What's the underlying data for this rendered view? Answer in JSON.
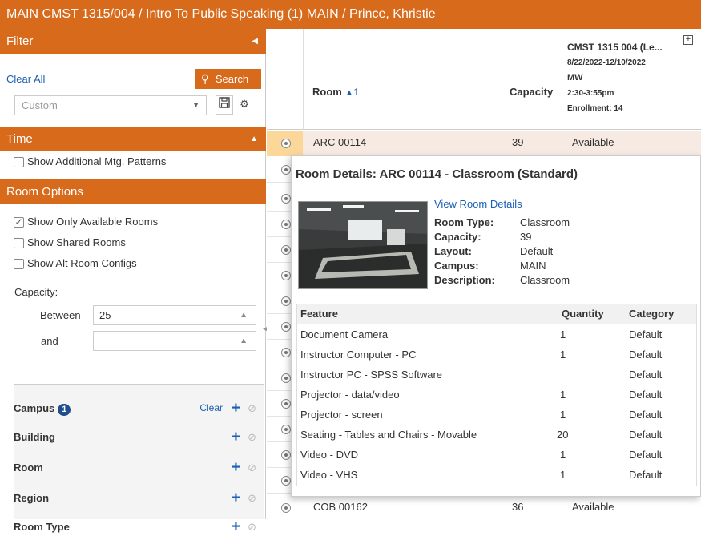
{
  "window_title": "MAIN CMST 1315/004 / Intro To Public Speaking (1) MAIN / Prince, Khristie",
  "filter": {
    "header": "Filter",
    "clear_all": "Clear All",
    "search_label": "Search",
    "preset_value": "Custom"
  },
  "time": {
    "header": "Time",
    "show_additional_label": "Show Additional Mtg. Patterns"
  },
  "room_options": {
    "header": "Room Options",
    "show_available_label": "Show Only Available Rooms",
    "show_available_checked": true,
    "show_shared_label": "Show Shared Rooms",
    "show_alt_label": "Show Alt Room Configs",
    "capacity_label": "Capacity:",
    "between_label": "Between",
    "between_value": "25",
    "and_label": "and",
    "and_value": ""
  },
  "facets": {
    "campus": {
      "label": "Campus",
      "count": "1",
      "clear": "Clear"
    },
    "building": {
      "label": "Building"
    },
    "room": {
      "label": "Room"
    },
    "region": {
      "label": "Region"
    },
    "room_type": {
      "label": "Room Type"
    }
  },
  "grid": {
    "room_header": "Room",
    "room_sort": "1",
    "capacity_header": "Capacity",
    "section": {
      "title": "CMST 1315 004 (Le...",
      "dates": "8/22/2022-12/10/2022",
      "days": "MW",
      "time": "2:30-3:55pm",
      "enrollment": "Enrollment: 14"
    },
    "rows": [
      {
        "room": "ARC 00114",
        "capacity": "39",
        "status": "Available"
      },
      {
        "room": "COB 00162",
        "capacity": "36",
        "status": "Available"
      }
    ]
  },
  "popup": {
    "title": "Room Details: ARC 00114 - Classroom (Standard)",
    "view_link": "View Room Details",
    "details": [
      {
        "label": "Room Type:",
        "value": "Classroom"
      },
      {
        "label": "Capacity:",
        "value": "39"
      },
      {
        "label": "Layout:",
        "value": "Default"
      },
      {
        "label": "Campus:",
        "value": "MAIN"
      },
      {
        "label": "Description:",
        "value": "Classroom"
      }
    ],
    "feature_headers": {
      "feature": "Feature",
      "quantity": "Quantity",
      "category": "Category"
    },
    "features": [
      {
        "feature": "Document Camera",
        "quantity": "1",
        "category": "Default"
      },
      {
        "feature": "Instructor Computer - PC",
        "quantity": "1",
        "category": "Default"
      },
      {
        "feature": "Instructor PC - SPSS Software",
        "quantity": "",
        "category": "Default"
      },
      {
        "feature": "Projector - data/video",
        "quantity": "1",
        "category": "Default"
      },
      {
        "feature": "Projector - screen",
        "quantity": "1",
        "category": "Default"
      },
      {
        "feature": "Seating - Tables and Chairs - Movable",
        "quantity": "20",
        "category": "Default"
      },
      {
        "feature": "Video - DVD",
        "quantity": "1",
        "category": "Default"
      },
      {
        "feature": "Video - VHS",
        "quantity": "1",
        "category": "Default"
      }
    ]
  },
  "colors": {
    "brand_orange": "#d86a1c",
    "link_blue": "#1a5fb4",
    "badge_navy": "#1e4f8c"
  },
  "icons": [
    "search-icon",
    "save-icon",
    "gear-icon",
    "collapse-left-icon",
    "collapse-up-icon",
    "dropdown-caret-icon",
    "spinner-icon",
    "add-icon",
    "disabled-icon",
    "radio-icon",
    "expand-icon",
    "room-photo"
  ]
}
